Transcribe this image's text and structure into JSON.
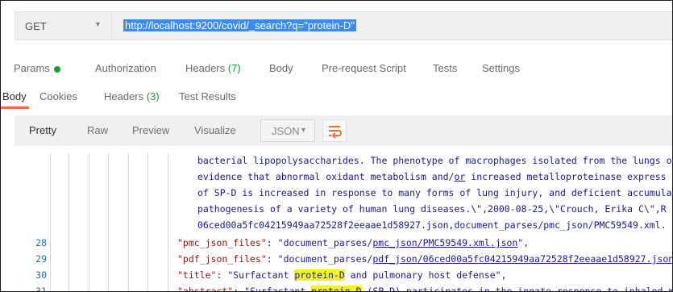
{
  "request": {
    "method": "GET",
    "url": "http://localhost:9200/covid/_search?q=\"protein-D\""
  },
  "request_tabs": {
    "params": "Params",
    "authorization": "Authorization",
    "headers": "Headers",
    "headers_count": "(7)",
    "body": "Body",
    "prerequest": "Pre-request Script",
    "tests": "Tests",
    "settings": "Settings"
  },
  "response_tabs": {
    "body": "Body",
    "cookies": "Cookies",
    "headers": "Headers",
    "headers_count": "(3)",
    "test_results": "Test Results"
  },
  "format_bar": {
    "pretty": "Pretty",
    "raw": "Raw",
    "preview": "Preview",
    "visualize": "Visualize",
    "format": "JSON"
  },
  "code": {
    "continuation": [
      "bacterial lipopolysaccharides. The phenotype of macrophages isolated from the lungs o",
      "evidence that abnormal oxidant metabolism and/or increased metalloproteinase express",
      "of SP-D is increased in response to many forms of lung injury, and deficient accumula",
      "pathogenesis of a variety of human lung diseases.\\\",2000-08-25,\\\"Crouch, Erika C\\\",R",
      "06ced00a5fc04215949aa72528f2eeaae1d58927.json,document_parses/pmc_json/PMC59549.xml."
    ],
    "lines": [
      {
        "num": "28",
        "key": "\"pmc_json_files\"",
        "sep": ": ",
        "pre": "\"document_parses/",
        "link": "pmc_json/PMC59549.xml.json",
        "post": "\","
      },
      {
        "num": "29",
        "key": "\"pdf_json_files\"",
        "sep": ": ",
        "pre": "\"document_parses/",
        "link": "pdf_json/06ced00a5fc04215949aa72528f2eeaae1d58927.json",
        "post": ""
      },
      {
        "num": "30",
        "key": "\"title\"",
        "sep": ": ",
        "pre": "\"Surfactant ",
        "hl": "protein-D",
        "post": " and pulmonary host defense\","
      },
      {
        "num": "31",
        "key": "\"abstract\"",
        "sep": ": ",
        "pre": "\"Surfactant ",
        "hl": "protein-D",
        "post": " (SP-D) participates in the innate response to inhaled m"
      }
    ]
  }
}
